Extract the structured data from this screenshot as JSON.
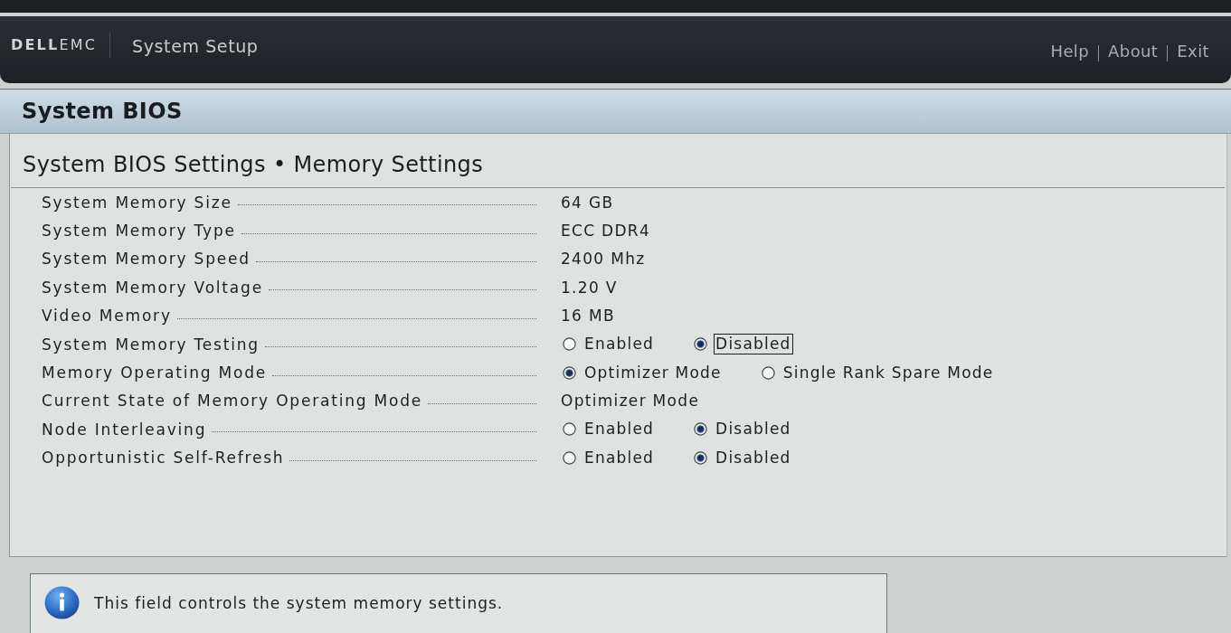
{
  "header": {
    "logo": "**DELL**EMC",
    "title": "System Setup",
    "links": [
      "Help",
      "About",
      "Exit"
    ]
  },
  "panel": {
    "title": "System BIOS",
    "breadcrumb": "System BIOS Settings • Memory Settings"
  },
  "settings": [
    {
      "label": "System Memory Size",
      "kind": "text",
      "value": "64 GB"
    },
    {
      "label": "System Memory Type",
      "kind": "text",
      "value": "ECC DDR4"
    },
    {
      "label": "System Memory Speed",
      "kind": "text",
      "value": "2400 Mhz"
    },
    {
      "label": "System Memory Voltage",
      "kind": "text",
      "value": "1.20 V"
    },
    {
      "label": "Video Memory",
      "kind": "text",
      "value": "16 MB"
    },
    {
      "label": "System Memory Testing",
      "kind": "radio",
      "options": [
        {
          "label": "Enabled",
          "selected": false,
          "focused": false
        },
        {
          "label": "Disabled",
          "selected": true,
          "focused": true
        }
      ]
    },
    {
      "label": "Memory Operating Mode",
      "kind": "radio",
      "options": [
        {
          "label": "Optimizer Mode",
          "selected": true,
          "focused": false
        },
        {
          "label": "Single Rank Spare Mode",
          "selected": false,
          "focused": false
        }
      ]
    },
    {
      "label": "Current State of Memory Operating Mode",
      "kind": "text",
      "value": "Optimizer Mode"
    },
    {
      "label": "Node Interleaving",
      "kind": "radio",
      "options": [
        {
          "label": "Enabled",
          "selected": false,
          "focused": false
        },
        {
          "label": "Disabled",
          "selected": true,
          "focused": false
        }
      ]
    },
    {
      "label": "Opportunistic Self-Refresh",
      "kind": "radio",
      "options": [
        {
          "label": "Enabled",
          "selected": false,
          "focused": false
        },
        {
          "label": "Disabled",
          "selected": true,
          "focused": false
        }
      ]
    }
  ],
  "help": {
    "text": "This field controls the system memory settings."
  }
}
